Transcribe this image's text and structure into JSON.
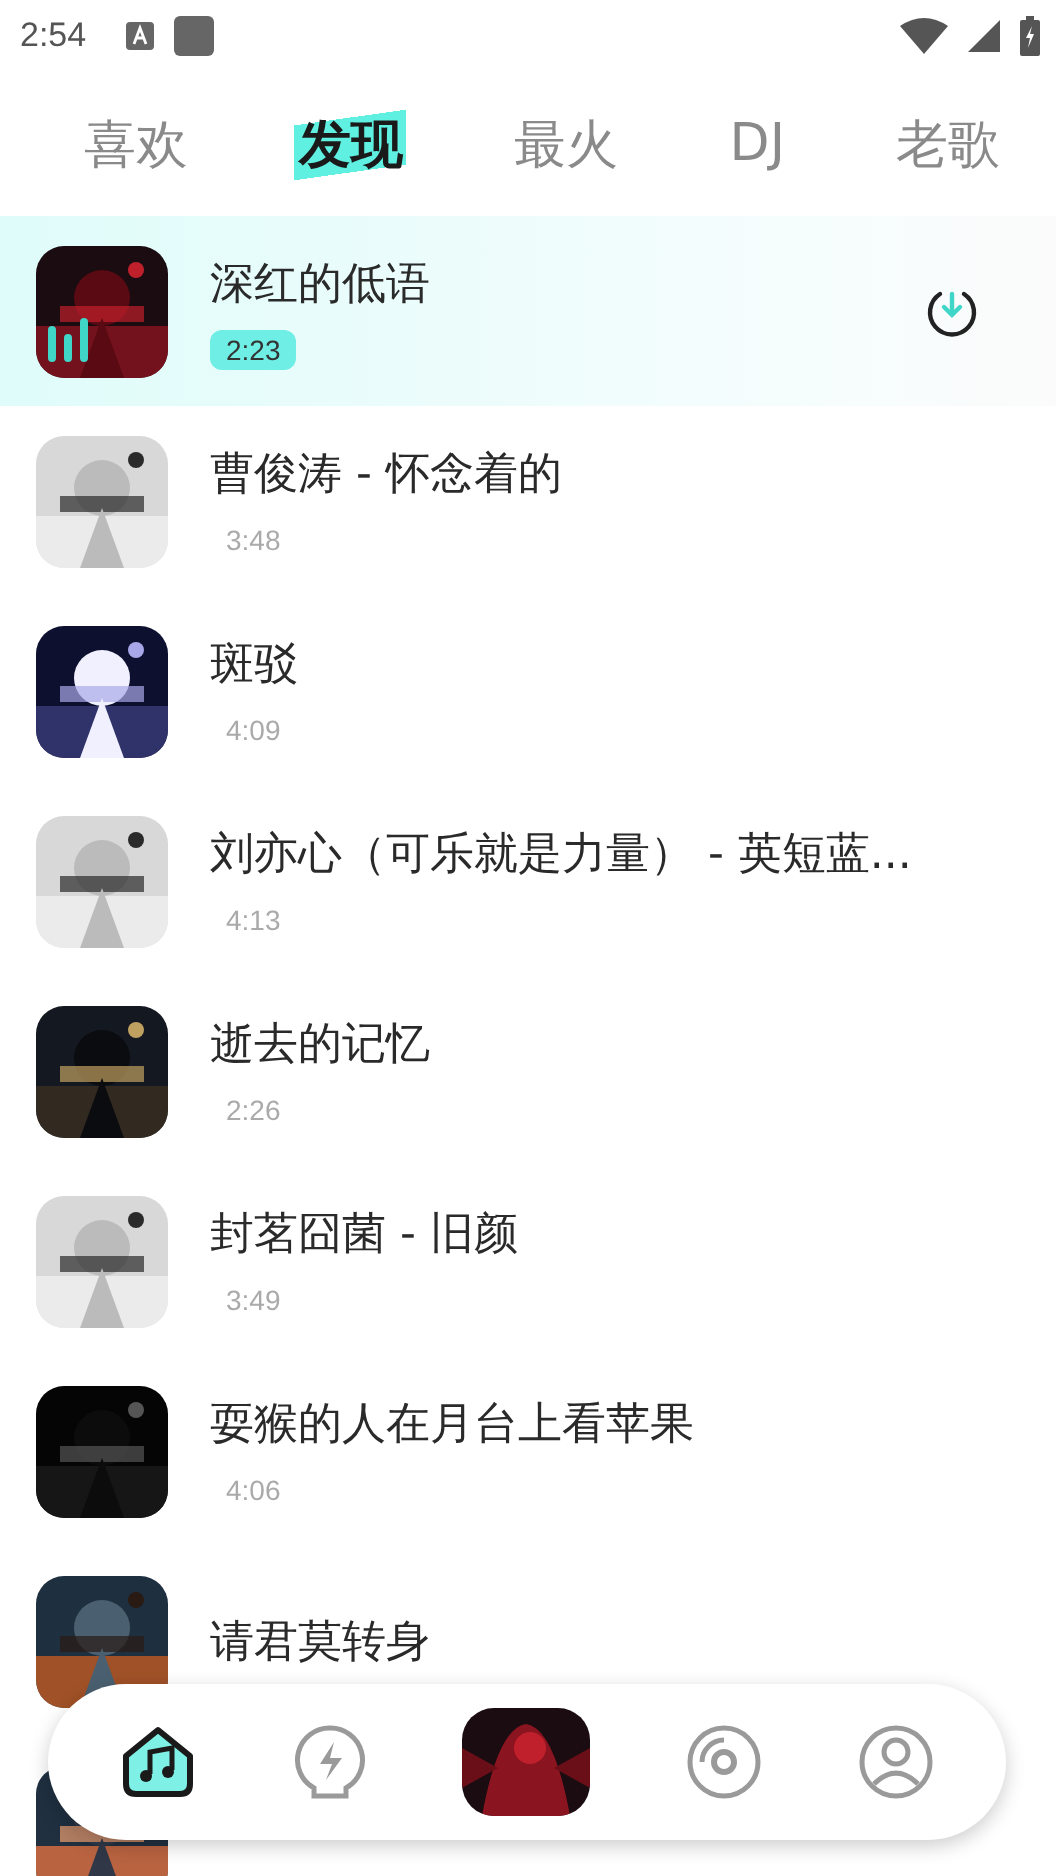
{
  "status_bar": {
    "time": "2:54"
  },
  "tabs": [
    {
      "label": "喜欢",
      "selected": false
    },
    {
      "label": "发现",
      "selected": true
    },
    {
      "label": "最火",
      "selected": false
    },
    {
      "label": "DJ",
      "selected": false
    },
    {
      "label": "老歌",
      "selected": false
    }
  ],
  "songs": [
    {
      "title": "深红的低语",
      "duration": "2:23",
      "playing": true
    },
    {
      "title": "曹俊涛 - 怀念着的",
      "duration": "3:48",
      "playing": false
    },
    {
      "title": "斑驳",
      "duration": "4:09",
      "playing": false
    },
    {
      "title": "刘亦心（可乐就是力量） - 英短蓝...",
      "duration": "4:13",
      "playing": false
    },
    {
      "title": "逝去的记忆",
      "duration": "2:26",
      "playing": false
    },
    {
      "title": "封茗囧菌 - 旧颜",
      "duration": "3:49",
      "playing": false
    },
    {
      "title": "耍猴的人在月台上看苹果",
      "duration": "4:06",
      "playing": false
    },
    {
      "title": "请君莫转身",
      "playing": false
    },
    {
      "playing": false
    }
  ],
  "nav": [
    {
      "kind": "icon",
      "selected": true
    },
    {
      "kind": "icon",
      "selected": false
    },
    {
      "kind": "cover",
      "selected": false
    },
    {
      "kind": "icon",
      "selected": false
    },
    {
      "kind": "icon",
      "selected": false
    }
  ]
}
